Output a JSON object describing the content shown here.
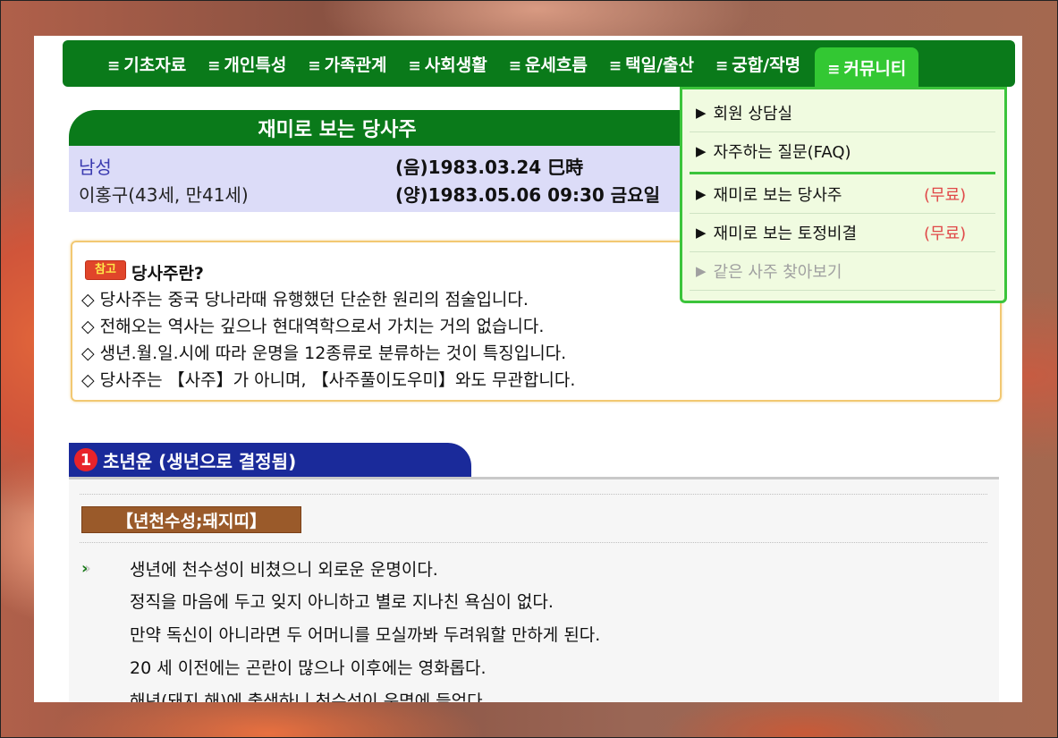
{
  "nav": {
    "items": [
      {
        "label": "기초자료"
      },
      {
        "label": "개인특성"
      },
      {
        "label": "가족관계"
      },
      {
        "label": "사회생활"
      },
      {
        "label": "운세흐름"
      },
      {
        "label": "택일/출산"
      },
      {
        "label": "궁합/작명"
      },
      {
        "label": "커뮤니티"
      }
    ],
    "active_index": 7,
    "menu_glyph": "≡"
  },
  "dropdown": {
    "items": [
      {
        "label": "회원 상담실",
        "tag": ""
      },
      {
        "label": "자주하는 질문(FAQ)",
        "tag": ""
      },
      {
        "label": "재미로 보는 당사주",
        "tag": "(무료)"
      },
      {
        "label": "재미로 보는 토정비결",
        "tag": "(무료)"
      },
      {
        "label": "같은 사주 찾아보기",
        "tag": ""
      }
    ],
    "bullet": "▶"
  },
  "title": "재미로 보는 당사주",
  "profile": {
    "gender": "남성",
    "name_age": "이홍구(43세, 만41세)",
    "lunar": "(음)1983.03.24 巳時",
    "solar": "(양)1983.05.06 09:30 금요일"
  },
  "note": {
    "badge": "참고",
    "heading": "당사주란?",
    "lines": [
      "◇ 당사주는 중국 당나라때 유행했던 단순한 원리의 점술입니다.",
      "◇ 전해오는 역사는 깊으나 현대역학으로서 가치는 거의 없습니다.",
      "◇ 생년.월.일.시에 따라 운명을 12종류로 분류하는 것이 특징입니다.",
      "◇ 당사주는 【사주】가 아니며, 【사주풀이도우미】와도 무관합니다."
    ]
  },
  "section1": {
    "number": "1",
    "title": "초년운 (생년으로 결정됨)",
    "star": "【년천수성;돼지띠】",
    "lines": [
      "생년에 천수성이 비쳤으니 외로운 운명이다.",
      "정직을 마음에 두고 잊지 아니하고 별로 지나친 욕심이 없다.",
      "만약 독신이 아니라면 두 어머니를 모실까봐 두려워할 만하게 된다.",
      "20 세 이전에는 곤란이 많으나 이후에는 영화롭다.",
      "해년(돼지 해)에 출생하니 천수성이 운명에 들었다."
    ]
  }
}
